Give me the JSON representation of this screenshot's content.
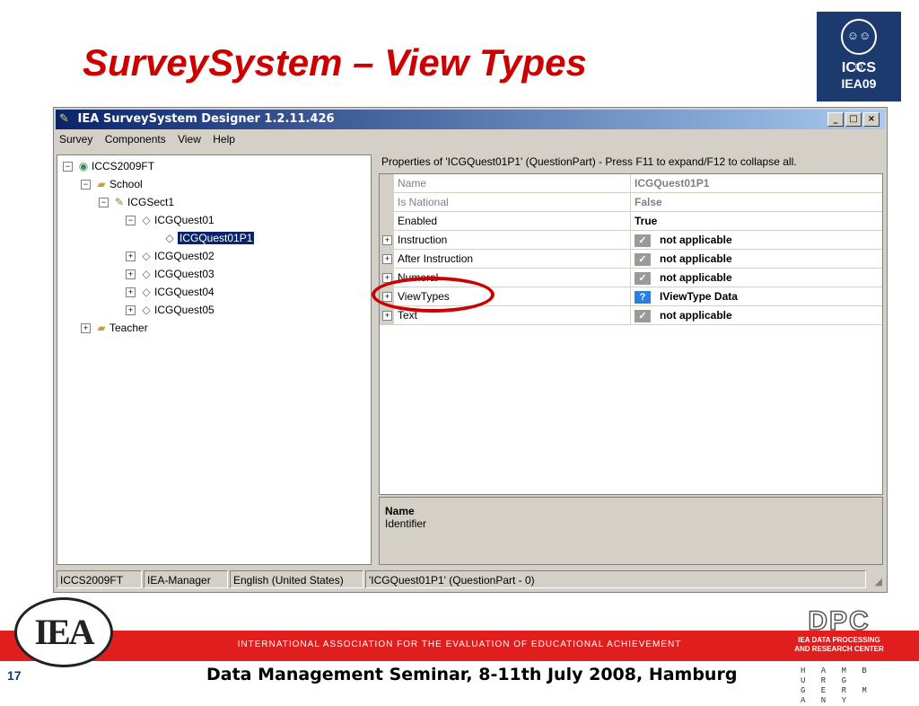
{
  "slide": {
    "title": "SurveySystem – View Types",
    "page_number": "17",
    "footer": "Data Management Seminar, 8-11th July 2008, Hamburg",
    "band_text": "INTERNATIONAL ASSOCIATION FOR THE EVALUATION OF EDUCATIONAL ACHIEVEMENT",
    "logo_iccs": {
      "line1": "ICCS",
      "line2": "IEA09"
    },
    "logo_iea": "IEA",
    "logo_dpc": {
      "mark": "DPC",
      "line1": "IEA DATA PROCESSING",
      "line2": "AND RESEARCH CENTER"
    },
    "city": "H A M B U R G",
    "country": "G E R M A N Y"
  },
  "window": {
    "title": "IEA SurveySystem Designer 1.2.11.426",
    "buttons": [
      "_",
      "□",
      "×"
    ],
    "menu": [
      "Survey",
      "Components",
      "View",
      "Help"
    ]
  },
  "tree": {
    "items": [
      {
        "label": "ICCS2009FT",
        "toggle": "−",
        "icon": "globe-icon"
      },
      {
        "label": "School",
        "toggle": "−",
        "icon": "folder-icon"
      },
      {
        "label": "ICGSect1",
        "toggle": "−",
        "icon": "section-icon"
      },
      {
        "label": "ICGQuest01",
        "toggle": "−",
        "icon": "question-icon"
      },
      {
        "label": "ICGQuest01P1",
        "toggle": "",
        "icon": "question-part-icon",
        "selected": true
      },
      {
        "label": "ICGQuest02",
        "toggle": "+",
        "icon": "question-icon"
      },
      {
        "label": "ICGQuest03",
        "toggle": "+",
        "icon": "question-icon"
      },
      {
        "label": "ICGQuest04",
        "toggle": "+",
        "icon": "question-icon"
      },
      {
        "label": "ICGQuest05",
        "toggle": "+",
        "icon": "question-icon"
      },
      {
        "label": "Teacher",
        "toggle": "+",
        "icon": "folder-icon"
      }
    ]
  },
  "properties": {
    "heading": "Properties of 'ICGQuest01P1' (QuestionPart) - Press F11 to expand/F12 to collapse all.",
    "rows": [
      {
        "name": "Name",
        "value": "ICGQuest01P1",
        "disabled": true,
        "expand": "",
        "icon": ""
      },
      {
        "name": "Is National",
        "value": "False",
        "disabled": true,
        "expand": "",
        "icon": ""
      },
      {
        "name": "Enabled",
        "value": "True",
        "disabled": false,
        "expand": "",
        "icon": ""
      },
      {
        "name": "Instruction",
        "value": "not applicable",
        "disabled": false,
        "expand": "+",
        "icon": "✓"
      },
      {
        "name": "After Instruction",
        "value": "not applicable",
        "disabled": false,
        "expand": "+",
        "icon": "✓"
      },
      {
        "name": "Numeral",
        "value": "not applicable",
        "disabled": false,
        "expand": "+",
        "icon": "✓"
      },
      {
        "name": "ViewTypes",
        "value": "IViewType Data",
        "disabled": false,
        "expand": "+",
        "icon": "?"
      },
      {
        "name": "Text",
        "value": "not applicable",
        "disabled": false,
        "expand": "+",
        "icon": "✓"
      }
    ],
    "description": {
      "title": "Name",
      "text": "Identifier"
    }
  },
  "statusbar": [
    "ICCS2009FT",
    "IEA-Manager",
    "English (United States)",
    "'ICGQuest01P1' (QuestionPart - 0)"
  ]
}
